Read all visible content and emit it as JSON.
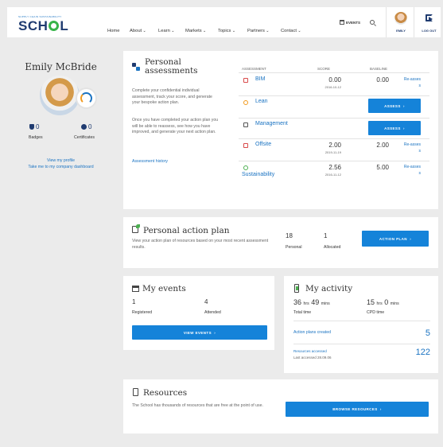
{
  "header": {
    "logo_top": "SUPPLY CHAIN SUSTAINABILITY",
    "logo_main_a": "SCH",
    "logo_main_b": "L",
    "nav": [
      "Home",
      "About",
      "Learn",
      "Markets",
      "Topics",
      "Partners",
      "Contact"
    ],
    "events_label": "EVENTS",
    "user_label": "EMILY",
    "logout_label": "LOG OUT"
  },
  "profile": {
    "name": "Emily McBride",
    "badges_count": "0",
    "badges_label": "Badges",
    "certificates_count": "0",
    "certificates_label": "Certificates",
    "view_profile": "View my profile",
    "take_to_dashboard": "Take me to my company dashboard"
  },
  "assessments": {
    "title_line1": "Personal",
    "title_line2": "assessments",
    "desc1": "Complete your confidential individual assessment, track your score, and generate your bespoke action plan.",
    "desc2": "Once you have completed your action plan you will be able to reassess, see how you have improved, and generate your next action plan.",
    "history_link": "Assessment history",
    "col_assessment": "ASSESSMENT",
    "col_score": "SCORE",
    "col_baseline": "BASELINE",
    "rows": [
      {
        "name": "BIM",
        "score": "0.00",
        "date": "2016-10-12",
        "baseline": "0.00",
        "action": "Re-asses",
        "action2": "s"
      },
      {
        "name": "Lean",
        "score": "",
        "date": "",
        "baseline": "",
        "action": "ASSESS"
      },
      {
        "name": "Management",
        "score": "",
        "date": "",
        "baseline": "",
        "action": "ASSESS"
      },
      {
        "name": "Offsite",
        "score": "2.00",
        "date": "2019-11-19",
        "baseline": "2.00",
        "action": "Re-asses",
        "action2": "s"
      },
      {
        "name": "Sustainability",
        "score": "2.56",
        "date": "2016-11-12",
        "baseline": "5.00",
        "action": "Re-asses",
        "action2": "s"
      }
    ]
  },
  "action_plan": {
    "title": "Personal action plan",
    "desc": "View your action plan of resources based on your most recent assessment results.",
    "personal_count": "18",
    "personal_label": "Personal",
    "allocated_count": "1",
    "allocated_label": "Allocated",
    "button": "ACTION PLAN"
  },
  "events": {
    "title": "My events",
    "registered_count": "1",
    "registered_label": "Registered",
    "attended_count": "4",
    "attended_label": "Attended",
    "button": "VIEW EVENTS"
  },
  "activity": {
    "title": "My activity",
    "total_h": "36",
    "total_m": "49",
    "hrs": "hrs",
    "mins": "mins",
    "total_label": "Total time",
    "cpd_h": "15",
    "cpd_m": "0",
    "cpd_label": "CPD time",
    "plans_label": "Action plans created",
    "plans_value": "5",
    "resources_label": "Resources accessed",
    "resources_sub": "Last accessed 28.09.06",
    "resources_value": "122"
  },
  "resources": {
    "title": "Resources",
    "desc": "The School has thousands of resources that are free at the point of use.",
    "button": "BROWSE RESOURCES"
  },
  "colors": {
    "accent": "#1583d9",
    "link": "#1a73c2",
    "orange": "#f29a1d",
    "green": "#4caf50",
    "red": "#d94b4b"
  }
}
